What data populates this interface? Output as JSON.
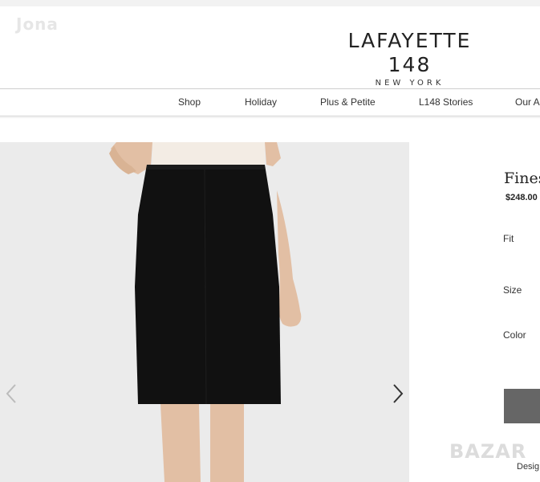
{
  "watermark_top": "Jona",
  "brand": {
    "name": "LAFAYETTE 148",
    "location": "NEW YORK"
  },
  "nav": {
    "items": [
      {
        "label": "Shop"
      },
      {
        "label": "Holiday"
      },
      {
        "label": "Plus & Petite"
      },
      {
        "label": "L148 Stories"
      },
      {
        "label": "Our Ap"
      }
    ]
  },
  "product": {
    "title": "Fines",
    "price": "$248.00",
    "fit_label": "Fit",
    "size_label": "Size",
    "color_label": "Color",
    "designer_label": "Desig"
  },
  "gallery": {
    "prev_icon": "chevron-left-icon",
    "next_icon": "chevron-right-icon"
  },
  "watermark_bottom": "BAZAR",
  "colors": {
    "skirt": "#111111",
    "blouse": "#f3ece4",
    "skin": "#e2bfa4",
    "hero_bg": "#ebebeb"
  }
}
